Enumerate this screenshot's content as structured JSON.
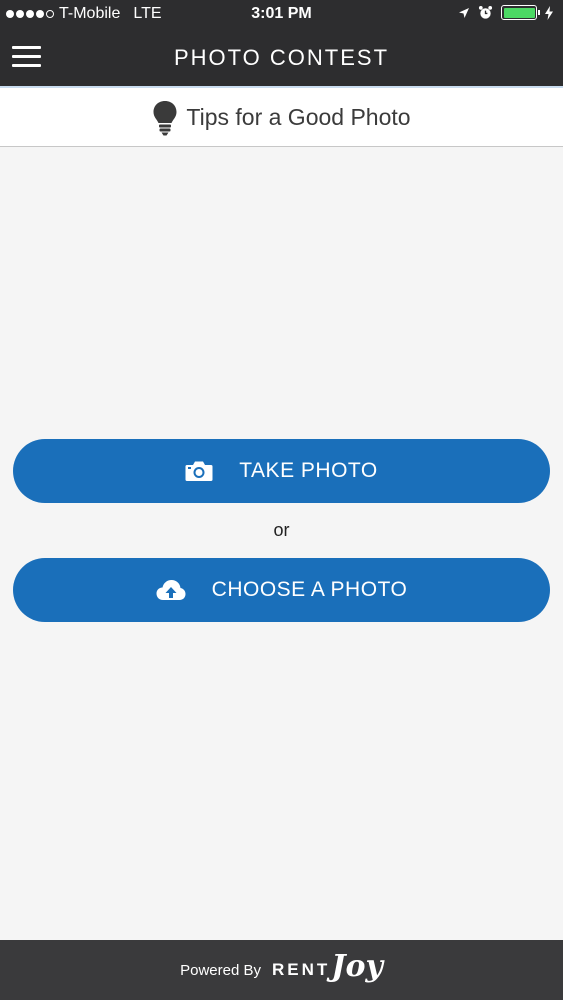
{
  "status_bar": {
    "carrier": "T-Mobile",
    "network": "LTE",
    "time": "3:01 PM",
    "battery_color": "#4cd964",
    "icons": [
      "location-arrow-icon",
      "alarm-icon",
      "battery-icon",
      "charging-bolt-icon"
    ]
  },
  "header": {
    "title": "PHOTO CONTEST",
    "menu_icon": "hamburger-menu-icon",
    "background": "#2d2d2f"
  },
  "tips": {
    "label": "Tips for a Good Photo",
    "icon": "lightbulb-icon"
  },
  "actions": {
    "take_photo_label": "TAKE PHOTO",
    "take_photo_icon": "camera-icon",
    "separator": "or",
    "choose_photo_label": "CHOOSE A PHOTO",
    "choose_photo_icon": "cloud-upload-icon",
    "button_color": "#1a6fba"
  },
  "footer": {
    "powered_by": "Powered By",
    "brand_rent": "RENT",
    "brand_joy": "Joy"
  }
}
